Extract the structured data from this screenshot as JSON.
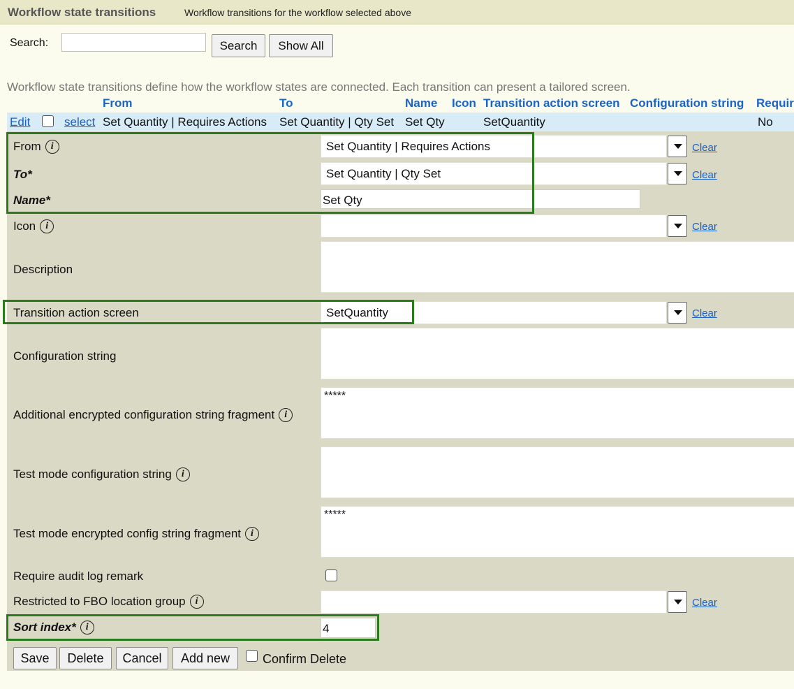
{
  "header": {
    "title": "Workflow state transitions",
    "subtitle": "Workflow transitions for the workflow selected above"
  },
  "search": {
    "label": "Search:",
    "value": "",
    "search_button": "Search",
    "show_all_button": "Show All"
  },
  "description": "Workflow state transitions define how the workflow states are connected. Each transition can present a tailored screen.",
  "table": {
    "columns": [
      "From",
      "To",
      "Name",
      "Icon",
      "Transition action screen",
      "Configuration string",
      "Requir"
    ],
    "row": {
      "edit": "Edit",
      "select": "select",
      "from": "Set Quantity | Requires Actions",
      "to": "Set Quantity | Qty Set",
      "name": "Set Qty",
      "icon": "",
      "action_screen": "SetQuantity",
      "config": "",
      "require": "No"
    }
  },
  "form": {
    "from": {
      "label": "From",
      "value": "Set Quantity | Requires Actions",
      "clear": "Clear"
    },
    "to": {
      "label": "To*",
      "value": "Set Quantity | Qty Set",
      "clear": "Clear"
    },
    "name": {
      "label": "Name*",
      "value": "Set Qty"
    },
    "icon": {
      "label": "Icon",
      "value": "",
      "clear": "Clear"
    },
    "description": {
      "label": "Description",
      "value": ""
    },
    "action_screen": {
      "label": "Transition action screen",
      "value": "SetQuantity",
      "clear": "Clear"
    },
    "config": {
      "label": "Configuration string",
      "value": ""
    },
    "add_encrypted": {
      "label": "Additional encrypted configuration string fragment",
      "value": "*****"
    },
    "test_config": {
      "label": "Test mode configuration string",
      "value": ""
    },
    "test_encrypted": {
      "label": "Test mode encrypted config string fragment",
      "value": "*****"
    },
    "audit": {
      "label": "Require audit log remark",
      "checked": false
    },
    "fbo": {
      "label": "Restricted to FBO location group",
      "value": "",
      "clear": "Clear"
    },
    "sort": {
      "label": "Sort index*",
      "value": "4"
    }
  },
  "buttons": {
    "save": "Save",
    "delete": "Delete",
    "cancel": "Cancel",
    "add_new": "Add new",
    "confirm_delete": "Confirm Delete"
  },
  "colors": {
    "header_bg": "#e8e8c8",
    "form_bg": "#dad9c5",
    "row_bg": "#d8ecf7",
    "link": "#1a5fc4",
    "highlight": "#2c7a1e"
  }
}
